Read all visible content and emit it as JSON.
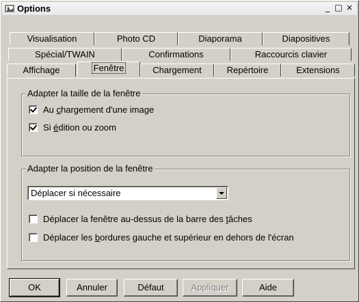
{
  "window": {
    "title": "Options",
    "controls": {
      "minimize": "_",
      "maximize": "□",
      "close": "×"
    }
  },
  "tabs": {
    "row1": [
      "Visualisation",
      "Photo CD",
      "Diaporama",
      "Diapositives"
    ],
    "row2": [
      "Spécial/TWAIN",
      "Confirmations",
      "Raccourcis clavier"
    ],
    "row3": [
      "Affichage",
      "Fenêtre",
      "Chargement",
      "Repértoire",
      "Extensions"
    ],
    "active": "Fenêtre"
  },
  "group_size": {
    "label": "Adapter la taille de la fenêtre",
    "options": [
      {
        "label_pre": "Au ",
        "label_u": "c",
        "label_post": "hargement d'une image",
        "checked": true
      },
      {
        "label_pre": "Si ",
        "label_u": "é",
        "label_post": "dition ou zoom",
        "checked": true
      }
    ]
  },
  "group_position": {
    "label": "Adapter la position de la fenêtre",
    "select_value": "Déplacer si nécessaire",
    "options": [
      {
        "label_pre": "Déplacer la fenêtre au-dessus de la barre des ",
        "label_u": "t",
        "label_post": "âches",
        "checked": false
      },
      {
        "label_pre": "Déplacer les ",
        "label_u": "b",
        "label_post": "ordures gauche et supérieur en dehors de l'écran",
        "checked": false
      }
    ]
  },
  "buttons": {
    "ok": "OK",
    "cancel": "Annuler",
    "default": "Défaut",
    "apply": "Appliquer",
    "help": "Aide"
  }
}
